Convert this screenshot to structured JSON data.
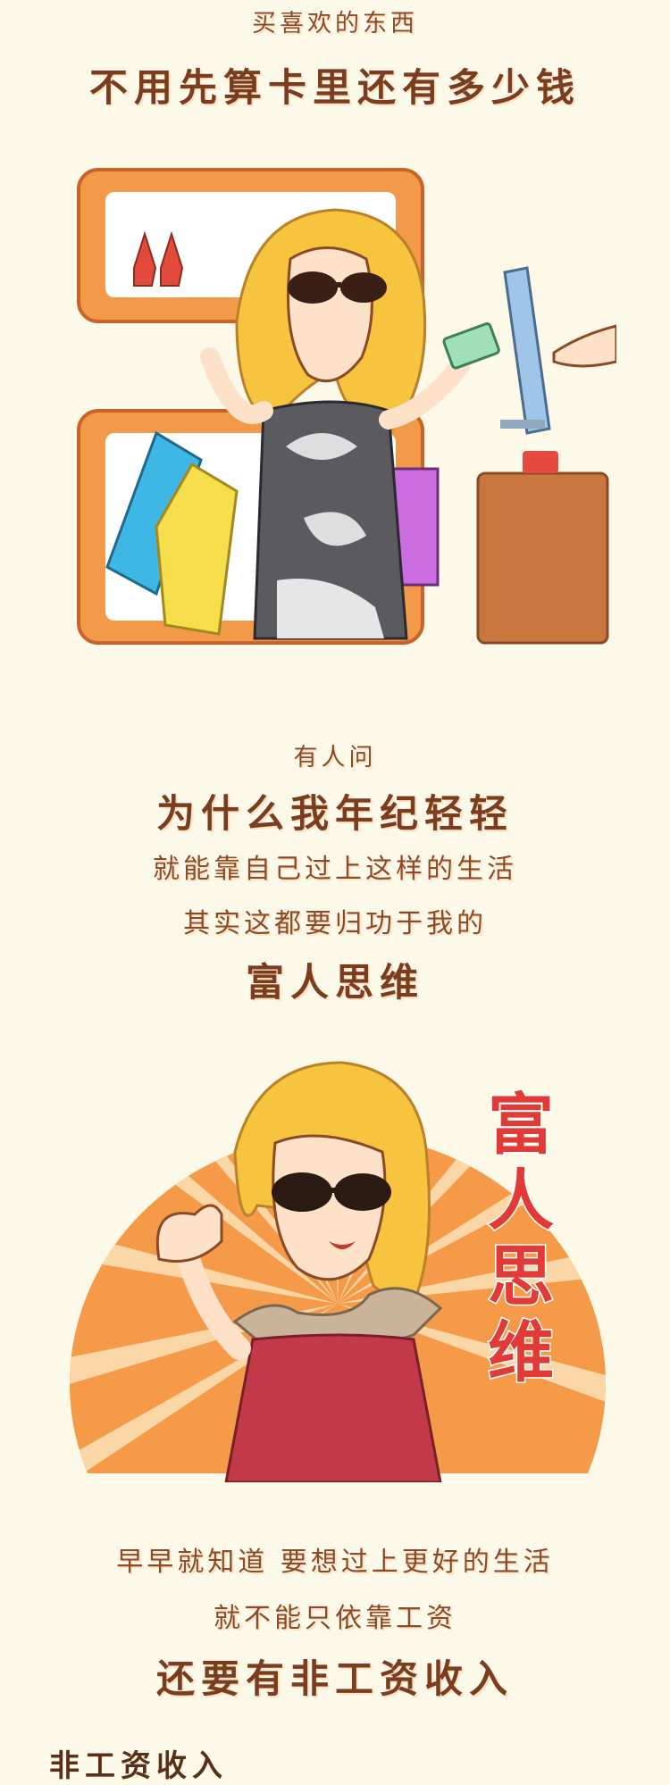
{
  "section1": {
    "line1": "买喜欢的东西",
    "line2": "不用先算卡里还有多少钱"
  },
  "section2": {
    "line1": "有人问",
    "line2": "为什么我年纪轻轻",
    "line3": "就能靠自己过上这样的生活",
    "line4": "其实这都要归功于我的",
    "line5": "富人思维"
  },
  "badge": {
    "char1": "富",
    "char2": "人",
    "char3": "思",
    "char4": "维"
  },
  "section3": {
    "line1": "早早就知道 要想过上更好的生活",
    "line2": "就不能只依靠工资",
    "line3": "还要有非工资收入"
  },
  "partial_heading": "非工资收入",
  "colors": {
    "background": "#fdf9e8",
    "text_brown": "#7a3d1e",
    "frame_orange": "#f08a3c",
    "badge_red": "#e23a36"
  }
}
